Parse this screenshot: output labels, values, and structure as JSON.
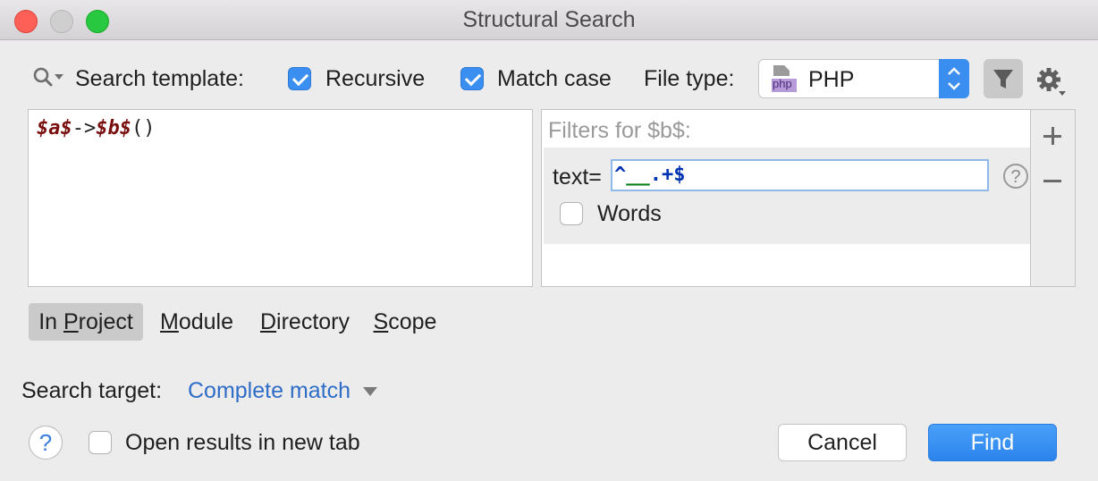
{
  "window": {
    "title": "Structural Search"
  },
  "toolbar": {
    "search_template_label": "Search template:",
    "recursive_label": "Recursive",
    "recursive_checked": true,
    "match_case_label": "Match case",
    "match_case_checked": true,
    "file_type_label": "File type:",
    "file_type_value": "PHP",
    "file_type_icon_text": "php"
  },
  "editor": {
    "tokens": [
      {
        "text": "$a$",
        "kind": "var"
      },
      {
        "text": "->",
        "kind": "plain"
      },
      {
        "text": "$b$",
        "kind": "var"
      },
      {
        "text": "()",
        "kind": "plain"
      }
    ]
  },
  "filters": {
    "header": "Filters for $b$:",
    "text_label": "text=",
    "text_value_parts": [
      {
        "text": "^",
        "color": "#0033b3"
      },
      {
        "text": "__",
        "color": "#067d17"
      },
      {
        "text": ".+",
        "color": "#0033b3"
      },
      {
        "text": "$",
        "color": "#0033b3"
      }
    ],
    "words_label": "Words",
    "words_checked": false
  },
  "scope": {
    "tabs": [
      {
        "label": "In ",
        "mnemonic": "P",
        "rest": "roject",
        "active": true
      },
      {
        "label": "",
        "mnemonic": "M",
        "rest": "odule",
        "active": false
      },
      {
        "label": "",
        "mnemonic": "D",
        "rest": "irectory",
        "active": false
      },
      {
        "label": "",
        "mnemonic": "S",
        "rest": "cope",
        "active": false
      }
    ]
  },
  "search_target": {
    "label": "Search target:",
    "value": "Complete match"
  },
  "footer": {
    "open_new_tab_label": "Open results in new tab",
    "open_new_tab_checked": false,
    "cancel_label": "Cancel",
    "find_label": "Find"
  },
  "colors": {
    "var_color": "#7a0f0f",
    "accent": "#3b8ff0",
    "link": "#2f6dc6"
  }
}
